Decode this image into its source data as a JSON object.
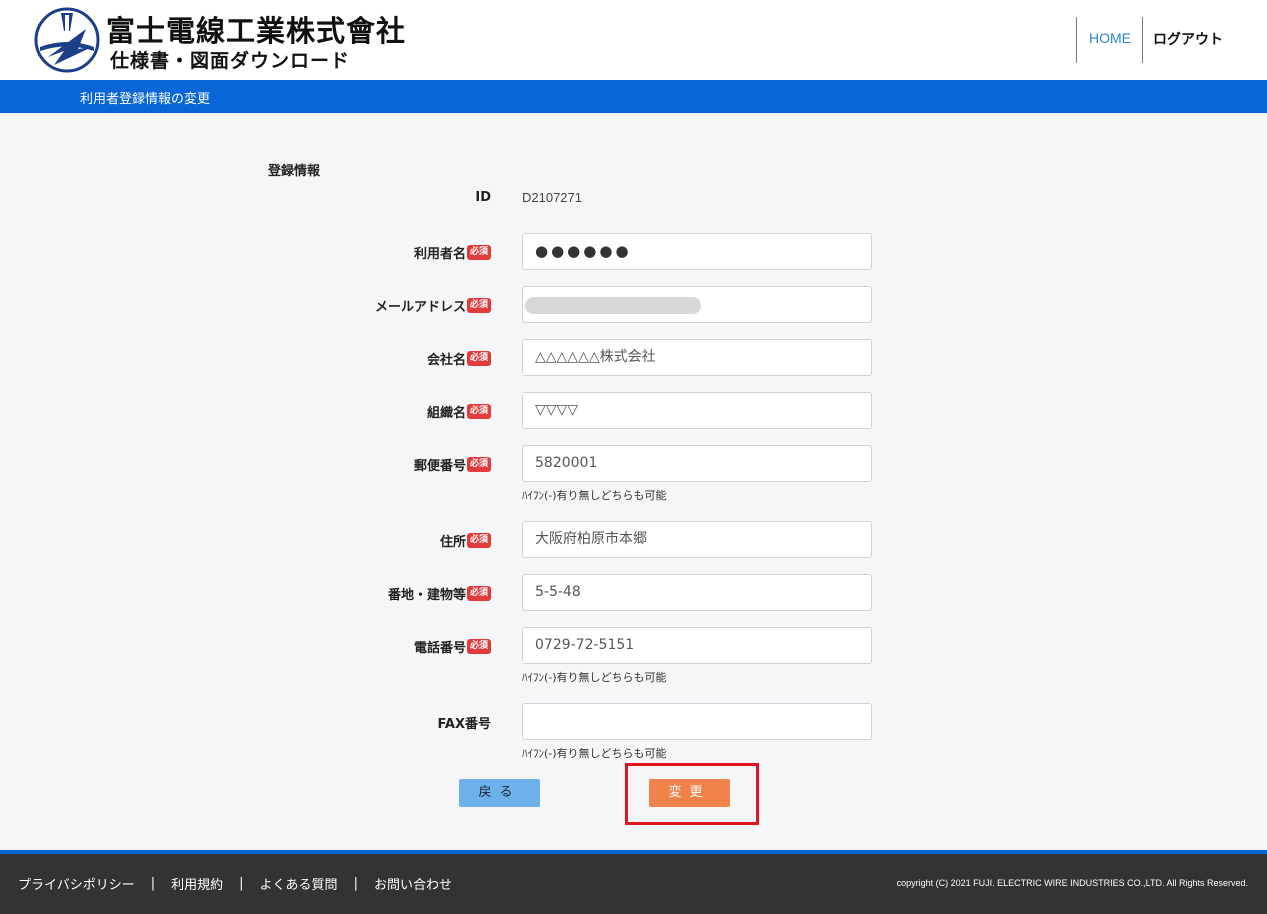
{
  "header": {
    "company_name": "富士電線工業株式會社",
    "site_subtitle": "仕様書・図面ダウンロード",
    "nav": {
      "home": "HOME",
      "logout": "ログアウト"
    }
  },
  "page_title": "利用者登録情報の変更",
  "form": {
    "section_title": "登録情報",
    "required_badge": "必須",
    "id": {
      "label": "ID",
      "value": "D2107271"
    },
    "fields": {
      "username": {
        "label": "利用者名",
        "value": "●●●●●●"
      },
      "email": {
        "label": "メールアドレス",
        "value": ""
      },
      "company": {
        "label": "会社名",
        "value": "△△△△△△株式会社"
      },
      "organization": {
        "label": "組織名",
        "value": "▽▽▽▽"
      },
      "postal": {
        "label": "郵便番号",
        "value": "5820001",
        "hint": "ﾊｲﾌﾝ(-)有り無しどちらも可能"
      },
      "address": {
        "label": "住所",
        "value": "大阪府柏原市本郷"
      },
      "street": {
        "label": "番地・建物等",
        "value": "5-5-48"
      },
      "phone": {
        "label": "電話番号",
        "value": "0729-72-5151",
        "hint": "ﾊｲﾌﾝ(-)有り無しどちらも可能"
      },
      "fax": {
        "label": "FAX番号",
        "value": "",
        "hint": "ﾊｲﾌﾝ(-)有り無しどちらも可能"
      }
    },
    "buttons": {
      "back": "戻る",
      "submit": "変更"
    }
  },
  "footer": {
    "links": [
      "プライバシポリシー",
      "利用規約",
      "よくある質問",
      "お問い合わせ"
    ],
    "separator": "|",
    "copyright": "copyright (C) 2021 FUJI. ELECTRIC WIRE INDUSTRIES CO.,LTD. All Rights Reserved."
  },
  "colors": {
    "header_bar": "#0866d6",
    "required_badge": "#e23b3b",
    "back_button": "#6cb1e9",
    "submit_button": "#f0824a",
    "highlight": "#e0161f",
    "footer": "#333333"
  }
}
